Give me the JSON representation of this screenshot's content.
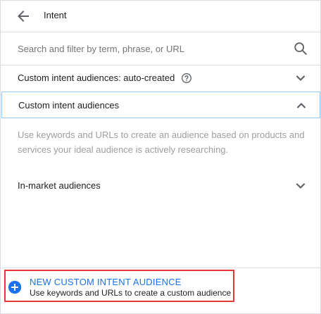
{
  "header": {
    "back_icon": "arrow-back-icon",
    "title": "Intent"
  },
  "search": {
    "placeholder": "Search and filter by term, phrase, or URL",
    "value": "",
    "icon": "search-icon"
  },
  "sections": [
    {
      "label": "Custom intent audiences: auto-created",
      "help_icon": "help-circle-icon",
      "state": "collapsed"
    },
    {
      "label": "Custom intent audiences",
      "state": "expanded",
      "description": "Use keywords and URLs to create an audience based on products and services your ideal audience is actively researching."
    },
    {
      "label": "In-market audiences",
      "state": "collapsed"
    }
  ],
  "footer": {
    "icon": "add-circle-icon",
    "title": "NEW CUSTOM INTENT AUDIENCE",
    "subtitle": "Use keywords and URLs to create a custom audience"
  },
  "colors": {
    "accent": "#1a73e8",
    "highlight_border": "#e53935",
    "selected_border": "#90caf9"
  }
}
